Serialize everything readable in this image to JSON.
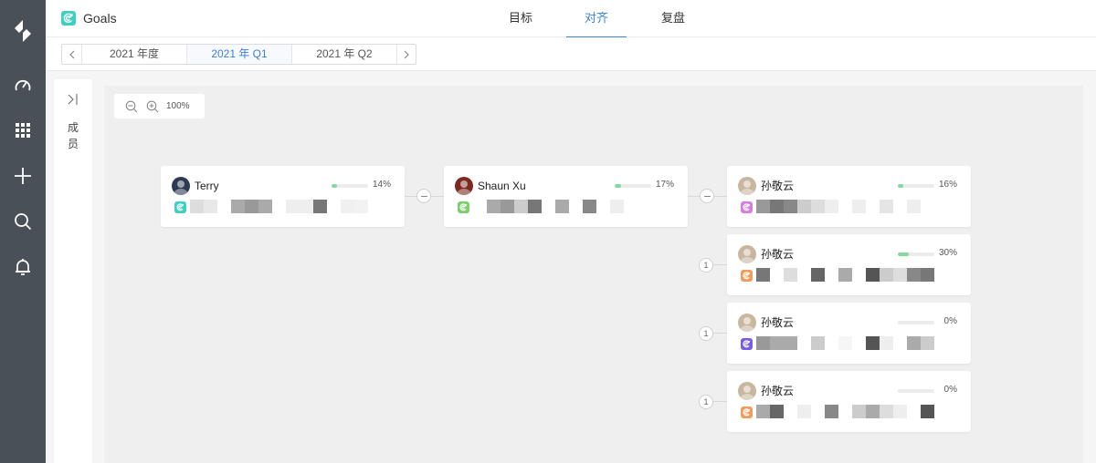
{
  "app": {
    "title": "Goals",
    "logo_icon": "goal-target-icon",
    "accent_color": "#3a7fd5"
  },
  "nav": {
    "items": [
      {
        "icon": "app-logo-icon"
      },
      {
        "icon": "dashboard-gauge-icon"
      },
      {
        "icon": "apps-grid-icon"
      },
      {
        "icon": "plus-icon"
      },
      {
        "icon": "search-icon"
      },
      {
        "icon": "bell-icon"
      }
    ]
  },
  "tabs": [
    {
      "label": "目标",
      "active": false
    },
    {
      "label": "对齐",
      "active": true
    },
    {
      "label": "复盘",
      "active": false
    }
  ],
  "periods": {
    "items": [
      {
        "label": "2021 年度",
        "active": false
      },
      {
        "label": "2021 年 Q1",
        "active": true
      },
      {
        "label": "2021 年 Q2",
        "active": false
      }
    ]
  },
  "members_panel": {
    "label": "成员"
  },
  "zoom": {
    "value": "100%"
  },
  "cards": [
    {
      "owner": "Terry",
      "progress_text": "14%",
      "progress": 0.14,
      "goal_icon_color": "#3ecfc0",
      "avatar_color": "#2e3a52"
    },
    {
      "owner": "Shaun Xu",
      "progress_text": "17%",
      "progress": 0.17,
      "goal_icon_color": "#7dcf6e",
      "avatar_color": "#7a2a22"
    },
    {
      "owner": "孙敬云",
      "progress_text": "16%",
      "progress": 0.16,
      "goal_icon_color": "#d67ee0",
      "avatar_color": "#c9b6a0"
    },
    {
      "owner": "孙敬云",
      "progress_text": "30%",
      "progress": 0.3,
      "goal_icon_color": "#f29b5c",
      "avatar_color": "#c9b6a0",
      "child_count": "1"
    },
    {
      "owner": "孙敬云",
      "progress_text": "0%",
      "progress": 0,
      "goal_icon_color": "#7b5be0",
      "avatar_color": "#c9b6a0",
      "child_count": "1"
    },
    {
      "owner": "孙敬云",
      "progress_text": "0%",
      "progress": 0,
      "goal_icon_color": "#f29b5c",
      "avatar_color": "#c9b6a0",
      "child_count": "1"
    }
  ]
}
